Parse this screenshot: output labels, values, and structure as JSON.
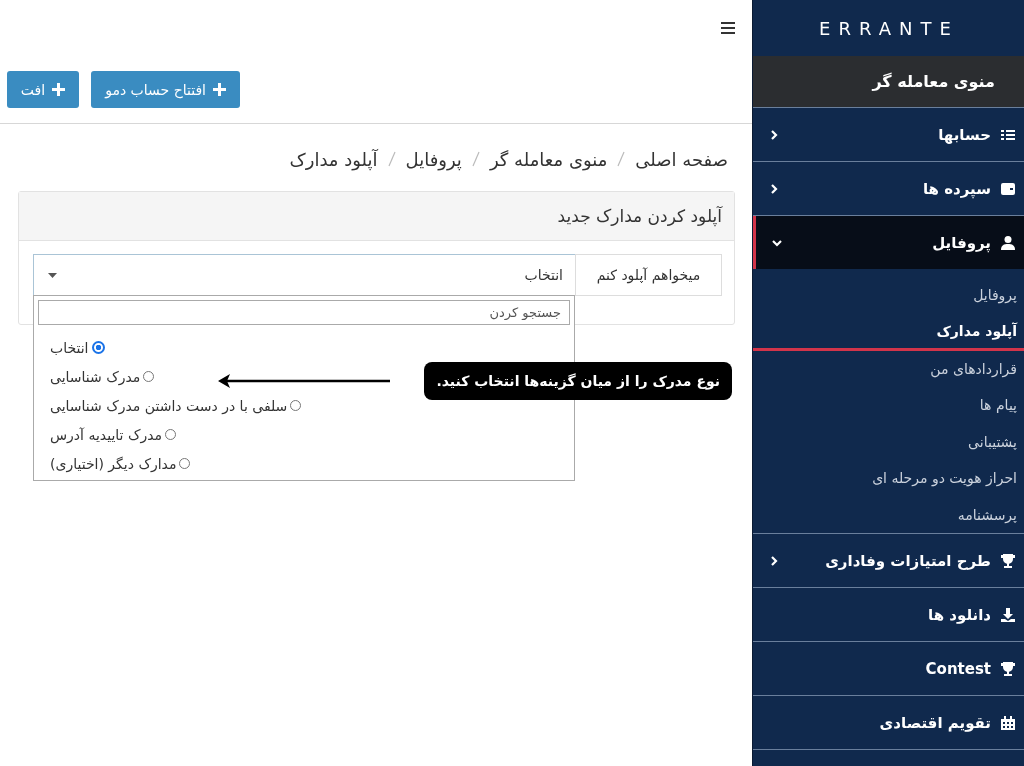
{
  "sidebar": {
    "logo": "ERRANTE",
    "header": "منوی معامله گر",
    "items": [
      {
        "label": "حسابها",
        "expanded": false
      },
      {
        "label": "سپرده ها",
        "expanded": false
      },
      {
        "label": "پروفایل",
        "expanded": true,
        "children": [
          {
            "label": "پروفایل",
            "selected": false
          },
          {
            "label": "آپلود مدارک",
            "selected": true
          },
          {
            "label": "قراردادهای من",
            "selected": false
          },
          {
            "label": "پیام ها",
            "selected": false
          },
          {
            "label": "پشتیبانی",
            "selected": false
          },
          {
            "label": "احراز هویت دو مرحله ای",
            "selected": false
          },
          {
            "label": "پرسشنامه",
            "selected": false
          }
        ]
      },
      {
        "label": "طرح امتیازات وفاداری",
        "expanded": false
      },
      {
        "label": "دانلود ها"
      },
      {
        "label": "Contest"
      },
      {
        "label": "تقویم اقتصادی"
      }
    ]
  },
  "buttons": [
    {
      "label": "افتتاح حساب دمو"
    },
    {
      "label": "افت"
    }
  ],
  "breadcrumb": [
    "صفحه اصلی",
    "منوی معامله گر",
    "پروفایل",
    "آپلود مدارک"
  ],
  "card": {
    "title": "آپلود کردن مدارک جدید",
    "field_label": "میخواهم آپلود کنم",
    "select": {
      "value": "انتخاب",
      "search": {
        "placeholder": "جستجو کردن"
      },
      "options": [
        {
          "label": "انتخاب",
          "selected": true
        },
        {
          "label": "مدرک شناسایی",
          "selected": false
        },
        {
          "label": "سلفی با در دست داشتن مدرک شناسایی",
          "selected": false
        },
        {
          "label": "مدرک تاییدیه آدرس",
          "selected": false
        },
        {
          "label": "مدارک دیگر (اختیاری)",
          "selected": false
        }
      ]
    }
  },
  "callout": "نوع مدرک را از میان گزینه‌ها انتخاب کنید."
}
